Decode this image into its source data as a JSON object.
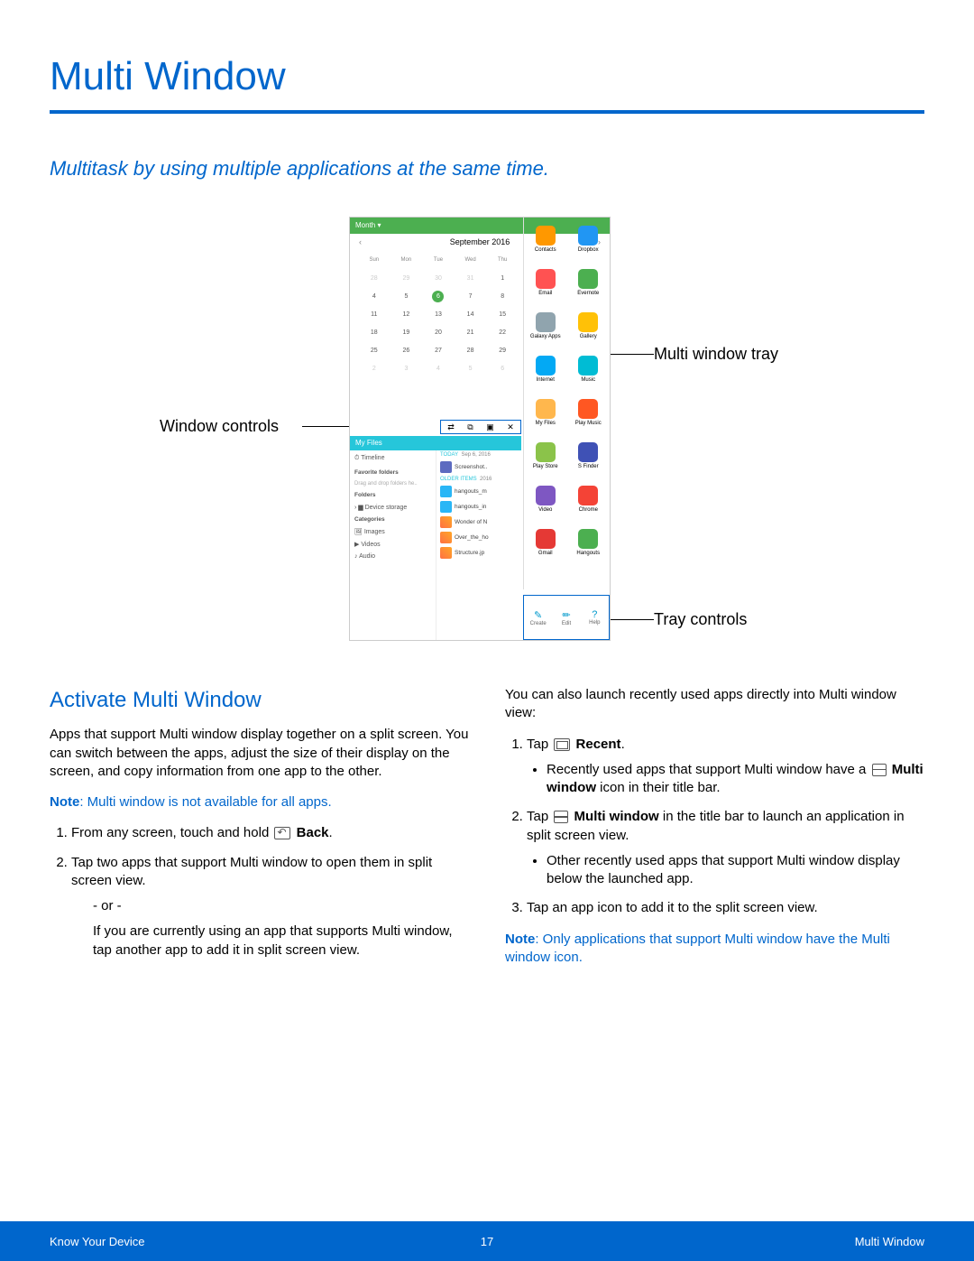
{
  "page": {
    "title": "Multi Window",
    "subtitle": "Multitask by using multiple applications at the same time."
  },
  "callouts": {
    "window_controls": "Window controls",
    "multi_window_tray": "Multi window tray",
    "tray_controls": "Tray controls"
  },
  "calendar": {
    "label": "Month ▾",
    "month": "September",
    "year": "2016",
    "days": [
      "Sun",
      "Mon",
      "Tue",
      "Wed",
      "Thu"
    ],
    "rows": [
      [
        "28",
        "29",
        "30",
        "31",
        "1"
      ],
      [
        "4",
        "5",
        "6",
        "7",
        "8"
      ],
      [
        "11",
        "12",
        "13",
        "14",
        "15"
      ],
      [
        "18",
        "19",
        "20",
        "21",
        "22"
      ],
      [
        "25",
        "26",
        "27",
        "28",
        "29"
      ],
      [
        "2",
        "3",
        "4",
        "5",
        "6"
      ]
    ],
    "highlight": "6"
  },
  "files": {
    "title": "My Files",
    "left": {
      "timeline": "Timeline",
      "fav_hdr": "Favorite folders",
      "fav_hint": "Drag and drop folders he..",
      "folders_hdr": "Folders",
      "device_storage": "Device storage",
      "categories_hdr": "Categories",
      "images": "Images",
      "videos": "Videos",
      "audio": "Audio"
    },
    "right": {
      "today_lbl": "TODAY",
      "today_date": "Sep 6, 2016",
      "item1": "Screenshot..",
      "older_lbl": "OLDER ITEMS",
      "older_year": "2016",
      "item2": "hangouts_m",
      "item3": "hangouts_in",
      "item4": "Wonder of N",
      "item5": "Over_the_ho",
      "item6": "Structure.jp"
    }
  },
  "tray_apps": [
    "Contacts",
    "Dropbox",
    "Email",
    "Evernote",
    "Galaxy Apps",
    "Gallery",
    "Internet",
    "Music",
    "My Files",
    "Play Music",
    "Play Store",
    "S Finder",
    "Video",
    "Chrome",
    "Gmail",
    "Hangouts"
  ],
  "tray_icons_colors": [
    "#ff9800",
    "#2196f3",
    "#ff5252",
    "#4caf50",
    "#90a4ae",
    "#ffc107",
    "#03a9f4",
    "#00bcd4",
    "#ffb74d",
    "#ff5722",
    "#8bc34a",
    "#3f51b5",
    "#7e57c2",
    "#f44336",
    "#e53935",
    "#4caf50"
  ],
  "tray_controls": {
    "create": "Create",
    "edit": "Edit",
    "help": "Help"
  },
  "section": {
    "h2": "Activate Multi Window",
    "p1": "Apps that support Multi window display together on a split screen. You can switch between the apps, adjust the size of their display on the screen, and copy information from one app to the other.",
    "note1_label": "Note",
    "note1": ": Multi window is not available for all apps.",
    "step1_pre": "From any screen, touch and hold ",
    "step1_bold": "Back",
    "step1_post": ".",
    "step2": "Tap two apps that support Multi window to open them in split screen view.",
    "or": "- or -",
    "step2_alt": "If you are currently using an app that supports Multi window, tap another app to add it in split screen view.",
    "p2": "You can also launch recently used apps directly into Multi window view:",
    "r1_pre": "Tap ",
    "r1_bold": "Recent",
    "r1_post": ".",
    "r1_bullet_pre": "Recently used apps that support Multi window have a ",
    "r1_bullet_bold": "Multi window",
    "r1_bullet_post": " icon in their title bar.",
    "r2_pre": "Tap ",
    "r2_bold": "Multi window",
    "r2_post": " in the title bar to launch an application in split screen view.",
    "r2_bullet": "Other recently used apps that support Multi window display below the launched app.",
    "r3": "Tap an app icon to add it to the split screen view.",
    "note2_label": "Note",
    "note2": ": Only applications that support Multi window have the Multi window icon."
  },
  "footer": {
    "left": "Know Your Device",
    "center": "17",
    "right": "Multi Window"
  }
}
